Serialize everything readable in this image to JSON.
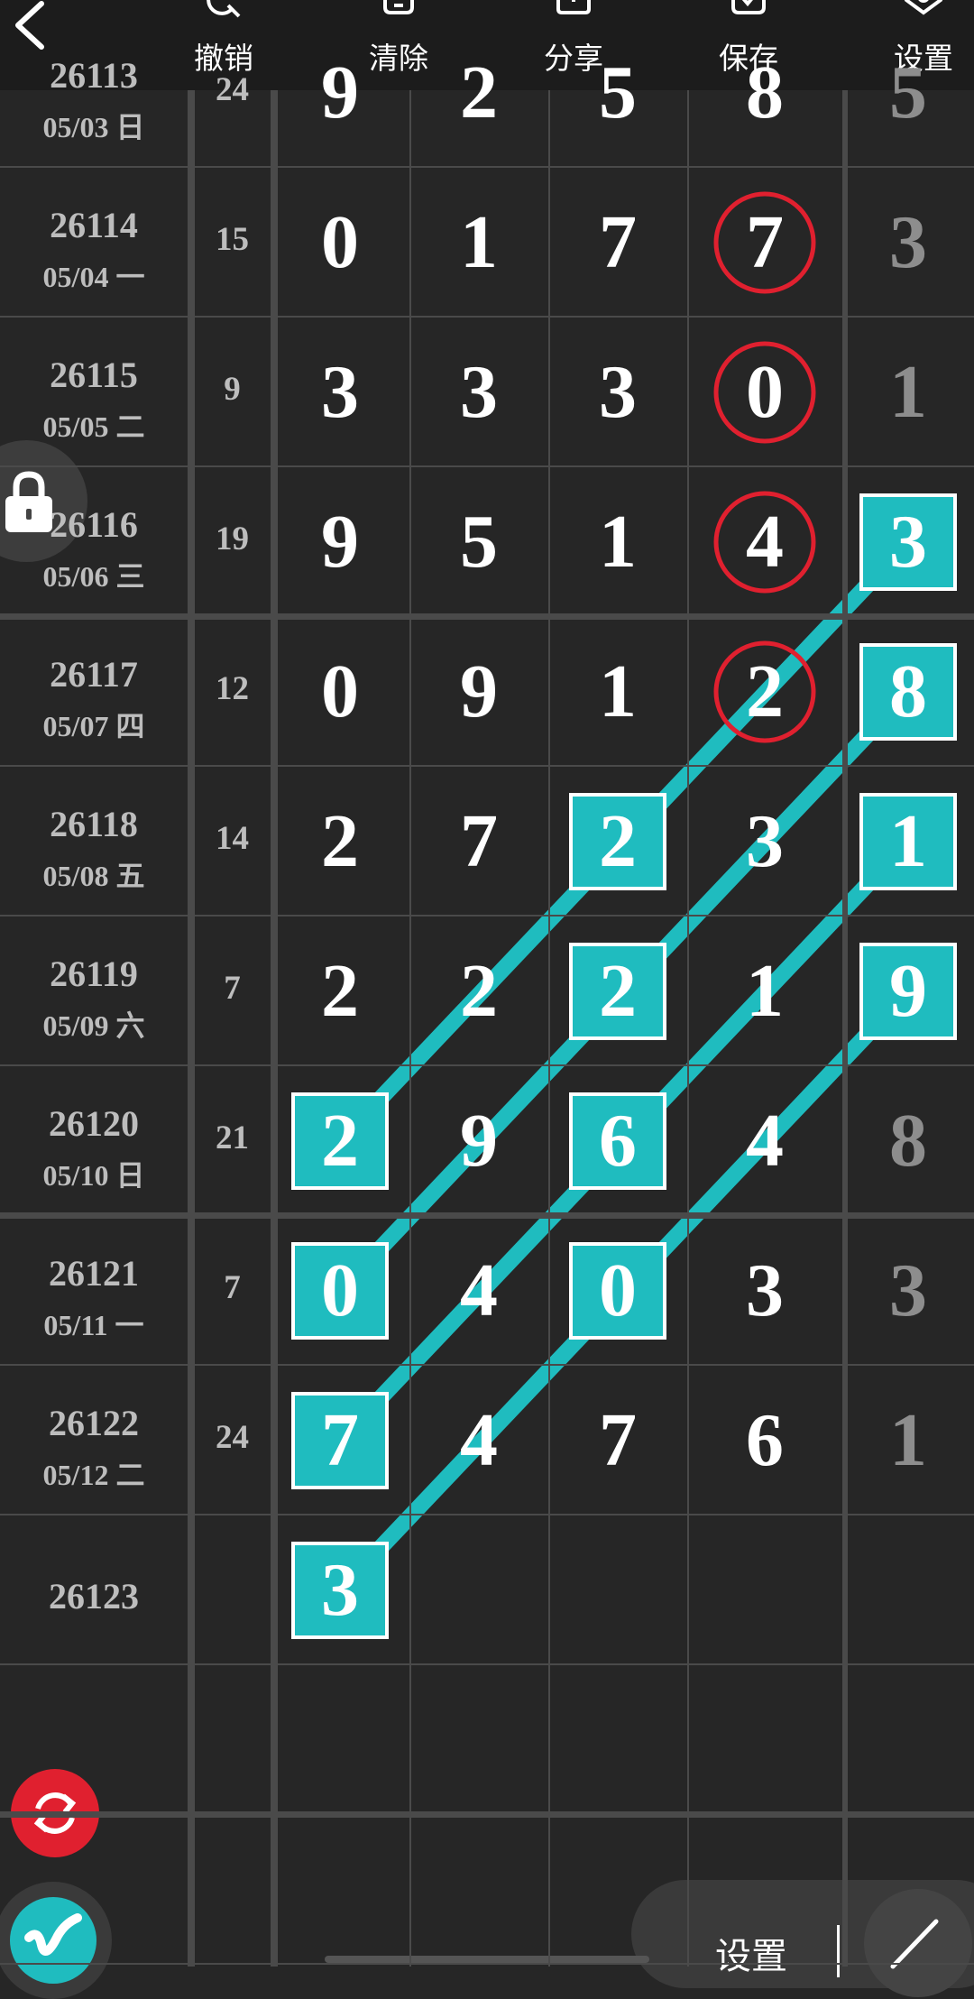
{
  "toolbar": {
    "buttons": [
      {
        "label": "撤销",
        "icon": "undo-icon"
      },
      {
        "label": "清除",
        "icon": "trash-icon"
      },
      {
        "label": "分享",
        "icon": "share-icon"
      },
      {
        "label": "保存",
        "icon": "save-icon"
      },
      {
        "label": "设置",
        "icon": "settings-icon"
      }
    ]
  },
  "rows": [
    {
      "issue": "26113",
      "date": "05/03 日",
      "sum": "24",
      "digits": [
        "9",
        "2",
        "5",
        "8",
        "5"
      ]
    },
    {
      "issue": "26114",
      "date": "05/04 一",
      "sum": "15",
      "digits": [
        "0",
        "1",
        "7",
        "7",
        "3"
      ]
    },
    {
      "issue": "26115",
      "date": "05/05 二",
      "sum": "9",
      "digits": [
        "3",
        "3",
        "3",
        "0",
        "1"
      ]
    },
    {
      "issue": "26116",
      "date": "05/06 三",
      "sum": "19",
      "digits": [
        "9",
        "5",
        "1",
        "4",
        "3"
      ]
    },
    {
      "issue": "26117",
      "date": "05/07 四",
      "sum": "12",
      "digits": [
        "0",
        "9",
        "1",
        "2",
        "8"
      ]
    },
    {
      "issue": "26118",
      "date": "05/08 五",
      "sum": "14",
      "digits": [
        "2",
        "7",
        "2",
        "3",
        "1"
      ]
    },
    {
      "issue": "26119",
      "date": "05/09 六",
      "sum": "7",
      "digits": [
        "2",
        "2",
        "2",
        "1",
        "9"
      ]
    },
    {
      "issue": "26120",
      "date": "05/10 日",
      "sum": "21",
      "digits": [
        "2",
        "9",
        "6",
        "4",
        "8"
      ]
    },
    {
      "issue": "26121",
      "date": "05/11 一",
      "sum": "7",
      "digits": [
        "0",
        "4",
        "0",
        "3",
        "3"
      ]
    },
    {
      "issue": "26122",
      "date": "05/12 二",
      "sum": "24",
      "digits": [
        "7",
        "4",
        "7",
        "6",
        "1"
      ]
    },
    {
      "issue": "26123",
      "date": "",
      "sum": "",
      "digits": [
        "3",
        "",
        "",
        "",
        ""
      ]
    }
  ],
  "marks": {
    "circled": [
      [
        1,
        3
      ],
      [
        2,
        3
      ],
      [
        3,
        3
      ],
      [
        4,
        3
      ]
    ],
    "boxed": [
      [
        3,
        4
      ],
      [
        4,
        4
      ],
      [
        5,
        4
      ],
      [
        6,
        4
      ],
      [
        5,
        2
      ],
      [
        6,
        2
      ],
      [
        7,
        2
      ],
      [
        8,
        2
      ],
      [
        7,
        0
      ],
      [
        8,
        0
      ],
      [
        9,
        0
      ],
      [
        10,
        0
      ]
    ],
    "lines": [
      [
        [
          3,
          4
        ],
        [
          7,
          0
        ]
      ],
      [
        [
          4,
          4
        ],
        [
          8,
          0
        ]
      ],
      [
        [
          5,
          4
        ],
        [
          9,
          0
        ]
      ],
      [
        [
          6,
          4
        ],
        [
          10,
          0
        ]
      ]
    ]
  },
  "colors": {
    "circle": "#e0202f",
    "box": "#1fbcbf",
    "line": "#1fbcbf",
    "grey_digit": "#8d8d8d"
  },
  "bottom": {
    "settings_label": "设置"
  }
}
